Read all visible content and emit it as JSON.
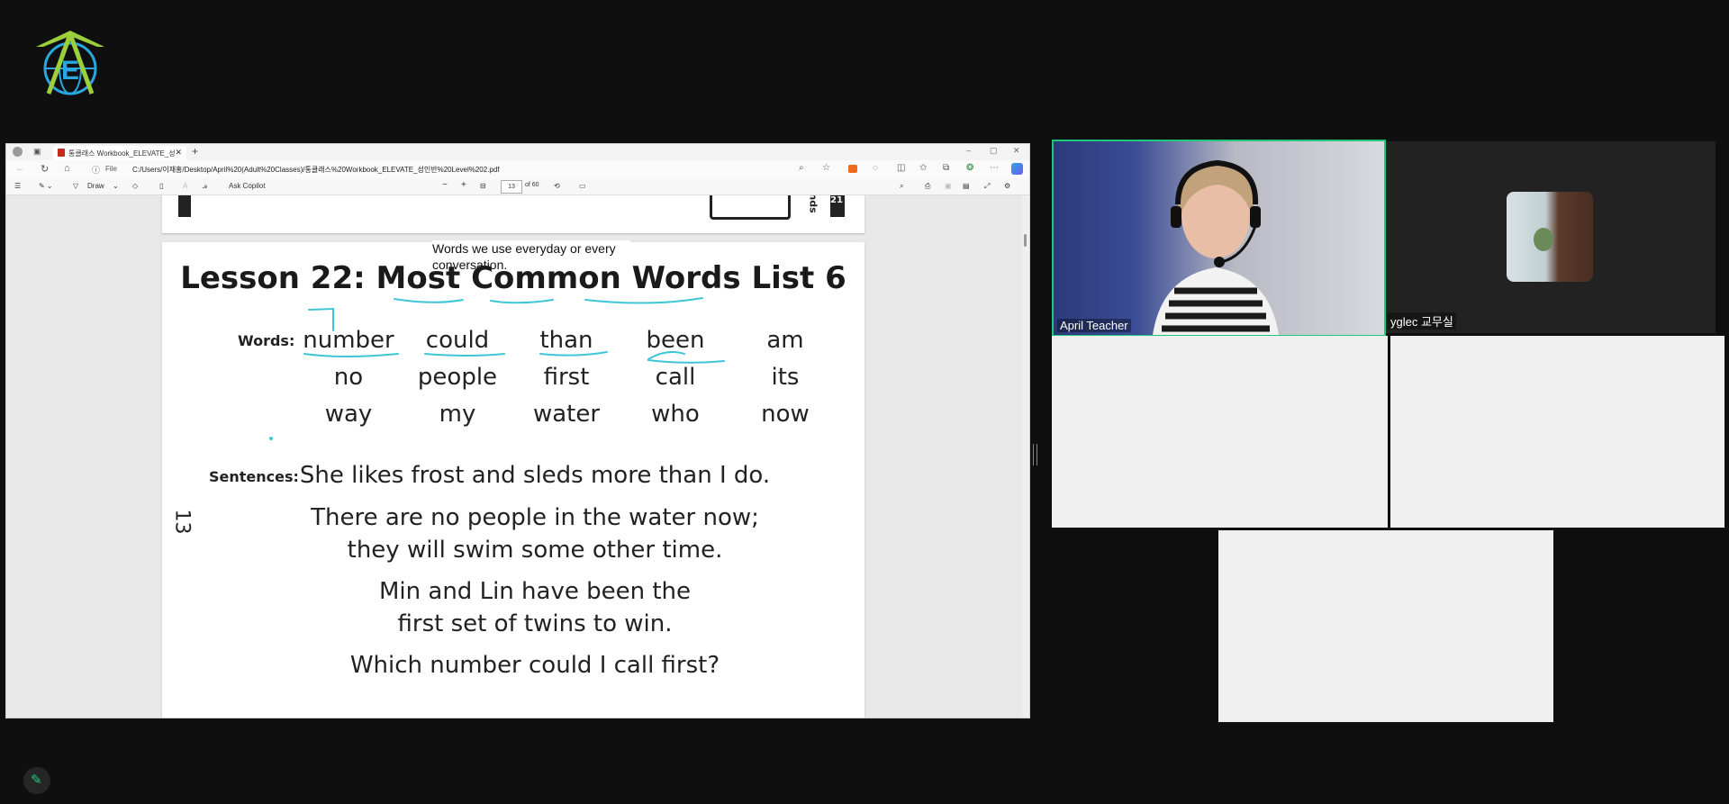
{
  "browser": {
    "tab_title": "통클래스 Workbook_ELEVATE_성",
    "new_tab": "+",
    "file_label": "File",
    "url": "C:/Users/이재홍/Desktop/April%20(Adult%20Classes)/통클래스%20Workbook_ELEVATE_성인반%20Level%202.pdf"
  },
  "pdf_toolbar": {
    "draw_label": "Draw",
    "copilot_label": "Ask Copilot",
    "page_number": "13",
    "page_total": "of 60"
  },
  "document": {
    "prev_page_tab": "nds",
    "prev_page_number": "21",
    "annotation_note": "Words we use everyday or every conversation.",
    "lesson_title": "Lesson 22: Most Common Words List 6",
    "words_label": "Words:",
    "words": [
      [
        "number",
        "could",
        "than",
        "been",
        "am"
      ],
      [
        "no",
        "people",
        "first",
        "call",
        "its"
      ],
      [
        "way",
        "my",
        "water",
        "who",
        "now"
      ]
    ],
    "sentences_label": "Sentences:",
    "sentences": [
      "She likes frost and sleds more than I do.",
      "There are no people in the water now;",
      "they will swim some other time.",
      "Min and Lin have been the",
      "first set of twins to win.",
      "Which number could I call first?"
    ],
    "page_number": "13"
  },
  "video": {
    "teacher_name": "April Teacher",
    "classroom_name": "yglec 교무실"
  },
  "colors": {
    "active_speaker_border": "#21c77a",
    "annotation_ink": "#3ec6d6",
    "logo_green": "#9ccf3a",
    "logo_blue": "#2aa6e0"
  }
}
